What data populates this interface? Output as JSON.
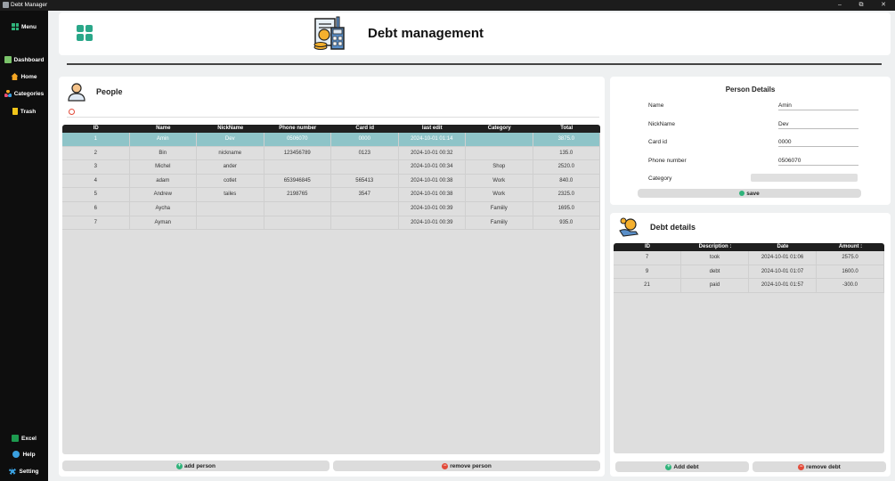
{
  "window": {
    "title": "Debt Manager",
    "controls": [
      "–",
      "⧉",
      "✕"
    ]
  },
  "sidebar": {
    "menu_label": "Menu",
    "items": [
      {
        "label": "Dashboard",
        "icon": "dashboard-icon",
        "color": "#7ac36a"
      },
      {
        "label": "Home",
        "icon": "home-icon",
        "color": "#f5a623"
      },
      {
        "label": "Categories",
        "icon": "categories-icon",
        "color": "#e94e77"
      },
      {
        "label": "Trash",
        "icon": "trash-icon",
        "color": "#f0c419"
      }
    ],
    "bottom": [
      {
        "label": "Excel",
        "icon": "excel-icon",
        "color": "#1d9a4f"
      },
      {
        "label": "Help",
        "icon": "help-icon",
        "color": "#3aa0e0"
      },
      {
        "label": "Setting",
        "icon": "setting-icon",
        "color": "#3aa0e0"
      }
    ]
  },
  "header": {
    "title": "Debt management"
  },
  "people": {
    "title": "People",
    "columns": [
      "ID",
      "Name",
      "NickName",
      "Phone number",
      "Card id",
      "last edit",
      "Category",
      "Total"
    ],
    "rows": [
      [
        "1",
        "Amin",
        "Dev",
        "0506070",
        "0000",
        "2024-10-01 01:14",
        "",
        "3875.0"
      ],
      [
        "2",
        "Bin",
        "nickname",
        "123456789",
        "0123",
        "2024-10-01 00:32",
        "",
        "135.0"
      ],
      [
        "3",
        "Michel",
        "ander",
        "",
        "",
        "2024-10-01 00:34",
        "Shop",
        "2520.0"
      ],
      [
        "4",
        "adam",
        "cotlet",
        "653946845",
        "565413",
        "2024-10-01 00:38",
        "Work",
        "840.0"
      ],
      [
        "5",
        "Andrew",
        "tailes",
        "2198765",
        "3547",
        "2024-10-01 00:38",
        "Work",
        "2325.0"
      ],
      [
        "6",
        "Aycha",
        "",
        "",
        "",
        "2024-10-01 00:39",
        "Famiily",
        "1695.0"
      ],
      [
        "7",
        "Ayman",
        "",
        "",
        "",
        "2024-10-01 00:39",
        "Famiily",
        "935.0"
      ]
    ],
    "selected_row": 0,
    "add_label": "add person",
    "remove_label": "remove person"
  },
  "details": {
    "title": "Person Details",
    "fields": [
      {
        "label": "Name",
        "value": "Amin"
      },
      {
        "label": "NickName",
        "value": "Dev"
      },
      {
        "label": "Card id",
        "value": "0000"
      },
      {
        "label": "Phone number",
        "value": "0506070"
      },
      {
        "label": "Category",
        "value": ""
      }
    ],
    "save_label": "save"
  },
  "debt": {
    "title": "Debt details",
    "columns": [
      "ID",
      "Description :",
      "Date",
      "Amount :"
    ],
    "rows": [
      [
        "7",
        "took",
        "2024-10-01 01:06",
        "2575.0"
      ],
      [
        "9",
        "debt",
        "2024-10-01 01:07",
        "1600.0"
      ],
      [
        "21",
        "paid",
        "2024-10-01 01:57",
        "-300.0"
      ]
    ],
    "add_label": "Add debt",
    "remove_label": "remove debt"
  },
  "colors": {
    "selected_row": "#8ec4c8",
    "accent": "#2aa789",
    "sidebar_bg": "#0e0e0e"
  }
}
